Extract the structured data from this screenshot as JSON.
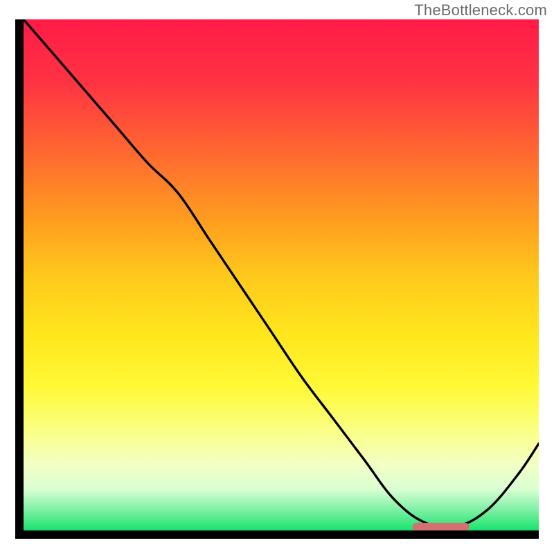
{
  "watermark": "TheBottleneck.com",
  "chart_data": {
    "type": "line",
    "title": "",
    "xlabel": "",
    "ylabel": "",
    "xlim": [
      0,
      100
    ],
    "ylim": [
      0,
      100
    ],
    "grid": false,
    "legend": false,
    "background": {
      "kind": "vertical_gradient",
      "stops": [
        {
          "y": 0.0,
          "color": "#ff1b47"
        },
        {
          "y": 0.12,
          "color": "#ff3243"
        },
        {
          "y": 0.25,
          "color": "#ff6431"
        },
        {
          "y": 0.4,
          "color": "#ffa01f"
        },
        {
          "y": 0.5,
          "color": "#ffc81c"
        },
        {
          "y": 0.62,
          "color": "#ffe71d"
        },
        {
          "y": 0.72,
          "color": "#fff937"
        },
        {
          "y": 0.8,
          "color": "#fbff80"
        },
        {
          "y": 0.87,
          "color": "#f3ffc4"
        },
        {
          "y": 0.92,
          "color": "#d9ffd3"
        },
        {
          "y": 0.96,
          "color": "#7df0a4"
        },
        {
          "y": 1.0,
          "color": "#17e36d"
        }
      ]
    },
    "series": [
      {
        "name": "bottleneck_curve",
        "color": "#000000",
        "x": [
          0.0,
          6.0,
          12.0,
          18.0,
          24.0,
          30.0,
          36.0,
          42.0,
          48.0,
          54.0,
          60.0,
          66.0,
          72.0,
          78.0,
          84.0,
          90.0,
          96.0,
          100.0
        ],
        "y": [
          100.0,
          93.0,
          86.0,
          79.0,
          72.0,
          66.0,
          57.0,
          48.0,
          39.0,
          30.0,
          22.0,
          14.0,
          6.0,
          1.5,
          0.8,
          4.0,
          11.0,
          17.0
        ]
      }
    ],
    "markers": [
      {
        "name": "optimal_band",
        "shape": "rounded_rect",
        "x_center": 81.0,
        "y_center": 0.7,
        "width": 11.0,
        "height": 1.6,
        "color": "#d66f70"
      }
    ]
  }
}
